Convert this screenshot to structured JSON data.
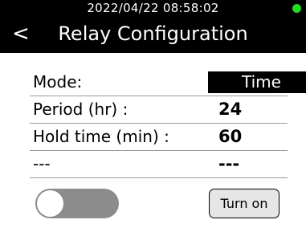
{
  "status_bar": {
    "datetime": "2022/04/22  08:58:02",
    "indicator_color": "#22dd22"
  },
  "header": {
    "back_symbol": "<",
    "title": "Relay Configuration"
  },
  "rows": [
    {
      "label": "Mode:",
      "value": "Time"
    },
    {
      "label": "Period  (hr)  :",
      "value": "24"
    },
    {
      "label": "Hold time  (min)  :",
      "value": "60"
    },
    {
      "label": "---",
      "value": "---"
    }
  ],
  "toggle": {
    "state": "off"
  },
  "turn_on_button": {
    "label": "Turn on"
  }
}
